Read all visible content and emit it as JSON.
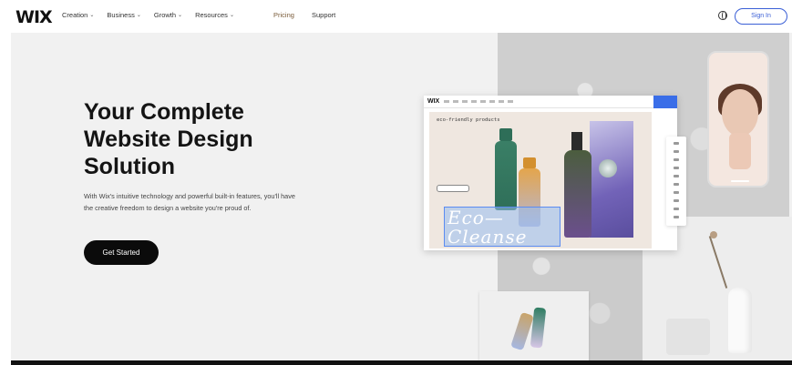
{
  "nav": {
    "logo": "WIX",
    "menu": [
      {
        "label": "Creation"
      },
      {
        "label": "Business"
      },
      {
        "label": "Growth"
      },
      {
        "label": "Resources"
      }
    ],
    "pricing": "Pricing",
    "support": "Support",
    "signin": "Sign In"
  },
  "hero": {
    "title": "Your Complete Website Design Solution",
    "description": "With Wix's intuitive technology and powerful built-in features, you'll have the creative freedom to design a website you're proud of.",
    "cta": "Get Started"
  },
  "editor": {
    "logo": "WIX",
    "eyebrow": "eco-friendly products",
    "headline": "Eco— Cleanse"
  },
  "icons": [
    "globe-icon",
    "chevron-down-icon"
  ]
}
